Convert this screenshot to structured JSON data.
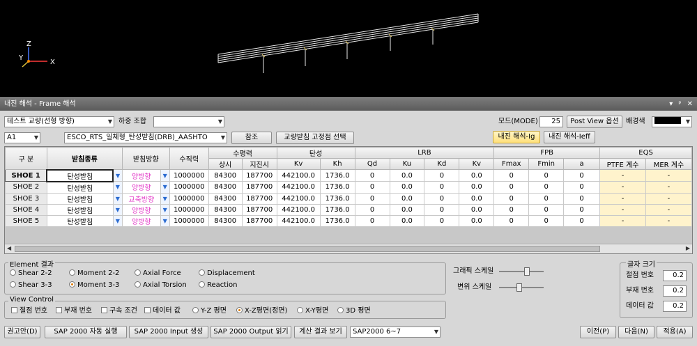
{
  "axes": {
    "z": "Z",
    "y": "Y",
    "x": "X"
  },
  "window_title": "내진 해석 - Frame 해석",
  "window_buttons": [
    "▾",
    "ᵖ",
    "✕"
  ],
  "toolbar1": {
    "bridge_select": "테스트 교량(선형 방향)",
    "load_combo_label": "하중 조합",
    "load_combo_value": "",
    "mode_label": "모드(MODE)",
    "mode_value": "25",
    "post_view_button": "Post View 옵션",
    "bg_color_label": "배경색",
    "bg_color": "#000000"
  },
  "toolbar2": {
    "pier_select": "A1",
    "model_select": "ESCO_RTS_일체형_탄성받침(DRB)_AASHTO",
    "ref_button": "참조",
    "fix_point_button": "교량받침 고정점 선택",
    "seismic_ig_button": "내진 해석-Ig",
    "seismic_ieff_button": "내진 해석-Ieff"
  },
  "table": {
    "head_groups": {
      "gubun": "구 분",
      "bearing_type": "받침종류",
      "bearing_dir": "받침방향",
      "vertical": "수직력",
      "horizontal": "수평력",
      "elastic": "탄성",
      "lrb": "LRB",
      "fpb": "FPB",
      "eqs": "EQS"
    },
    "sub_heads": {
      "h_normal": "상시",
      "h_quake": "지진시",
      "kv": "Kv",
      "kh": "Kh",
      "qd": "Qd",
      "ku": "Ku",
      "kd": "Kd",
      "lrb_kv": "Kv",
      "fmax": "Fmax",
      "fmin": "Fmin",
      "a": "a",
      "ptfe": "PTFE 계수",
      "mer": "MER 계수"
    },
    "rows": [
      {
        "name": "SHOE 1",
        "type": "탄성받침",
        "dir": "양방향",
        "vert": "1000000",
        "hn": "84300",
        "hq": "187700",
        "kv": "442100.0",
        "kh": "1736.0",
        "qd": "0",
        "ku": "0.0",
        "kd": "0",
        "lkv": "0.0",
        "fmax": "0",
        "fmin": "0",
        "a": "0",
        "ptfe": "-",
        "mer": "-"
      },
      {
        "name": "SHOE 2",
        "type": "탄성받침",
        "dir": "양방향",
        "vert": "1000000",
        "hn": "84300",
        "hq": "187700",
        "kv": "442100.0",
        "kh": "1736.0",
        "qd": "0",
        "ku": "0.0",
        "kd": "0",
        "lkv": "0.0",
        "fmax": "0",
        "fmin": "0",
        "a": "0",
        "ptfe": "-",
        "mer": "-"
      },
      {
        "name": "SHOE 3",
        "type": "탄성받침",
        "dir": "교축방향",
        "vert": "1000000",
        "hn": "84300",
        "hq": "187700",
        "kv": "442100.0",
        "kh": "1736.0",
        "qd": "0",
        "ku": "0.0",
        "kd": "0",
        "lkv": "0.0",
        "fmax": "0",
        "fmin": "0",
        "a": "0",
        "ptfe": "-",
        "mer": "-"
      },
      {
        "name": "SHOE 4",
        "type": "탄성받침",
        "dir": "양방향",
        "vert": "1000000",
        "hn": "84300",
        "hq": "187700",
        "kv": "442100.0",
        "kh": "1736.0",
        "qd": "0",
        "ku": "0.0",
        "kd": "0",
        "lkv": "0.0",
        "fmax": "0",
        "fmin": "0",
        "a": "0",
        "ptfe": "-",
        "mer": "-"
      },
      {
        "name": "SHOE 5",
        "type": "탄성받침",
        "dir": "양방향",
        "vert": "1000000",
        "hn": "84300",
        "hq": "187700",
        "kv": "442100.0",
        "kh": "1736.0",
        "qd": "0",
        "ku": "0.0",
        "kd": "0",
        "lkv": "0.0",
        "fmax": "0",
        "fmin": "0",
        "a": "0",
        "ptfe": "-",
        "mer": "-"
      }
    ]
  },
  "element_results": {
    "title": "Element 결과",
    "options": [
      "Shear 2-2",
      "Moment 2-2",
      "Axial Force",
      "Displacement",
      "Shear 3-3",
      "Moment 3-3",
      "Axial Torsion",
      "Reaction"
    ],
    "selected": "Moment 3-3"
  },
  "graphic": {
    "scale_label": "그래픽 스케일",
    "disp_scale_label": "변위 스케일",
    "scale_level": 0.65,
    "disp_scale_level": 0.45
  },
  "font_size": {
    "title": "글자 크기",
    "node_label": "절점 번호",
    "node_value": "0.2",
    "member_label": "부재 번호",
    "member_value": "0.2",
    "data_label": "데이터 값",
    "data_value": "0.2"
  },
  "view_control": {
    "title": "View Control",
    "checks": [
      "절점 번호",
      "부재 번호",
      "구속 조건",
      "데이터 값"
    ],
    "planes": [
      "Y-Z 평면",
      "X-Z평면(정면)",
      "X-Y평면",
      "3D 평면"
    ],
    "selected_plane": "X-Z평면(정면)"
  },
  "bottom": {
    "recommend": "권고안(D)",
    "sap_run": "SAP 2000 자동 실행",
    "sap_input": "SAP 2000 Input 생성",
    "sap_output": "SAP 2000 Output 읽기",
    "calc_view": "계산 결과 보기",
    "sap_version": "SAP2000 6~7",
    "prev": "이전(P)",
    "next": "다음(N)",
    "apply": "적용(A)"
  }
}
